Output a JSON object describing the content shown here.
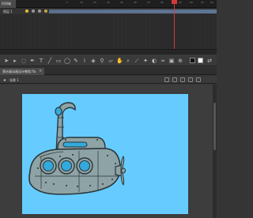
{
  "timeline": {
    "tab_label": "时间轴",
    "ruler_numbers": [
      "5",
      "10",
      "15",
      "20",
      "25",
      "30",
      "35",
      "40",
      "45",
      "50",
      "55",
      "60"
    ],
    "layer_name": "图层 1",
    "playhead_frame": "60"
  },
  "tools": {
    "icons": [
      "selection-tool-icon",
      "subselection-tool-icon",
      "lasso-tool-icon",
      "pen-tool-icon",
      "text-tool-icon",
      "line-tool-icon",
      "rectangle-tool-icon",
      "oval-tool-icon",
      "pencil-tool-icon",
      "brush-tool-icon",
      "paint-bucket-icon",
      "eyedropper-icon",
      "eraser-tool-icon",
      "hand-tool-icon",
      "zoom-tool-icon"
    ],
    "stroke_color": "#111111",
    "fill_color": "#ffffff"
  },
  "document": {
    "tab_label": "潜水艇动画设计教程.fla",
    "close_label": "×",
    "scene_label": "场景 1"
  },
  "stage": {
    "background": "#66ccff",
    "hull_color": "#8ea3a6",
    "window_color": "#33aadd"
  }
}
